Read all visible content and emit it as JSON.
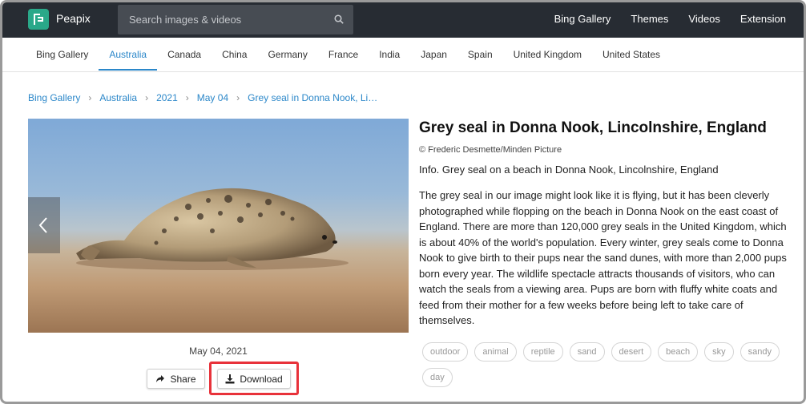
{
  "header": {
    "brand": "Peapix",
    "search_placeholder": "Search images & videos",
    "nav": [
      "Bing Gallery",
      "Themes",
      "Videos",
      "Extension"
    ]
  },
  "categories": [
    "Bing Gallery",
    "Australia",
    "Canada",
    "China",
    "Germany",
    "France",
    "India",
    "Japan",
    "Spain",
    "United Kingdom",
    "United States"
  ],
  "active_category": "Australia",
  "breadcrumb": [
    "Bing Gallery",
    "Australia",
    "2021",
    "May 04",
    "Grey seal in Donna Nook, Li…"
  ],
  "image": {
    "date": "May 04, 2021"
  },
  "actions": {
    "share": "Share",
    "download": "Download"
  },
  "detail": {
    "title": "Grey seal in Donna Nook, Lincolnshire, England",
    "credit": "© Frederic Desmette/Minden Picture",
    "info": "Info. Grey seal on a beach in Donna Nook, Lincolnshire, England",
    "description": "The grey seal in our image might look like it is flying, but it has been cleverly photographed while flopping on the beach in Donna Nook on the east coast of England. There are more than 120,000 grey seals in the United Kingdom, which is about 40% of the world's population. Every winter, grey seals come to Donna Nook to give birth to their pups near the sand dunes, with more than 2,000 pups born every year. The wildlife spectacle attracts thousands of visitors, who can watch the seals from a viewing area. Pups are born with fluffy white coats and feed from their mother for a few weeks before being left to take care of themselves."
  },
  "tags": [
    "outdoor",
    "animal",
    "reptile",
    "sand",
    "desert",
    "beach",
    "sky",
    "sandy",
    "day"
  ],
  "colors": {
    "topbar": "#272c33",
    "accent": "#2b87c9",
    "logo": "#2aa889",
    "highlight": "#e8323a"
  }
}
